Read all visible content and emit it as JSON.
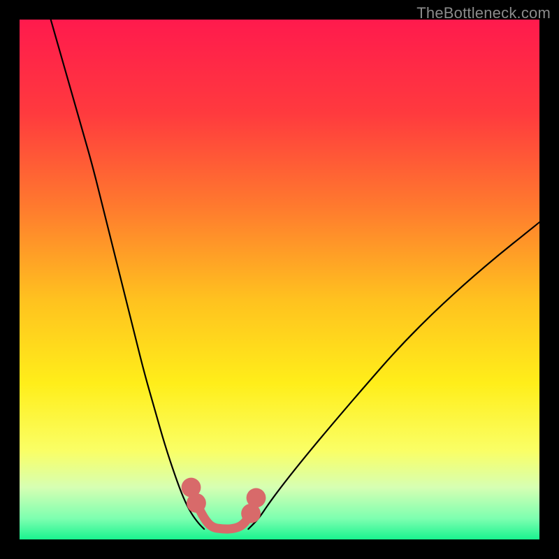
{
  "watermark": "TheBottleneck.com",
  "chart_data": {
    "type": "line",
    "title": "",
    "xlabel": "",
    "ylabel": "",
    "xlim": [
      0,
      100
    ],
    "ylim": [
      0,
      100
    ],
    "grid": false,
    "legend": false,
    "background_gradient_stops": [
      {
        "offset": 0,
        "color": "#ff1a4d"
      },
      {
        "offset": 0.18,
        "color": "#ff3a3e"
      },
      {
        "offset": 0.36,
        "color": "#ff7a2e"
      },
      {
        "offset": 0.54,
        "color": "#ffc21f"
      },
      {
        "offset": 0.7,
        "color": "#ffee1a"
      },
      {
        "offset": 0.83,
        "color": "#faff66"
      },
      {
        "offset": 0.9,
        "color": "#d6ffb3"
      },
      {
        "offset": 0.96,
        "color": "#7dffb0"
      },
      {
        "offset": 1.0,
        "color": "#19f38f"
      }
    ],
    "series": [
      {
        "name": "left-branch",
        "stroke": "#000000",
        "x": [
          6,
          8,
          10,
          12,
          14,
          16,
          18,
          20,
          22,
          24,
          26,
          28,
          30,
          31.5,
          33,
          34.5,
          35.5
        ],
        "y": [
          100,
          93,
          86,
          79,
          72,
          64,
          56,
          48,
          40,
          32,
          25,
          18,
          12,
          8,
          5,
          3,
          2
        ]
      },
      {
        "name": "right-branch",
        "stroke": "#000000",
        "x": [
          44,
          46,
          48,
          51,
          55,
          60,
          66,
          73,
          81,
          90,
          100
        ],
        "y": [
          2,
          4,
          7,
          11,
          16,
          22,
          29,
          37,
          45,
          53,
          61
        ]
      },
      {
        "name": "bottom-plateau",
        "stroke": "#d86a6a",
        "x": [
          33,
          34,
          35.5,
          37,
          39,
          41,
          43,
          44.5,
          45.5
        ],
        "y": [
          10,
          7,
          4,
          2.3,
          2,
          2,
          2.7,
          5,
          8
        ]
      }
    ],
    "points": [
      {
        "x": 33,
        "y": 10,
        "r": 1.2,
        "color": "#d86a6a"
      },
      {
        "x": 34,
        "y": 7,
        "r": 1.2,
        "color": "#d86a6a"
      },
      {
        "x": 44.5,
        "y": 5,
        "r": 1.2,
        "color": "#d86a6a"
      },
      {
        "x": 45.5,
        "y": 8,
        "r": 1.2,
        "color": "#d86a6a"
      }
    ]
  }
}
